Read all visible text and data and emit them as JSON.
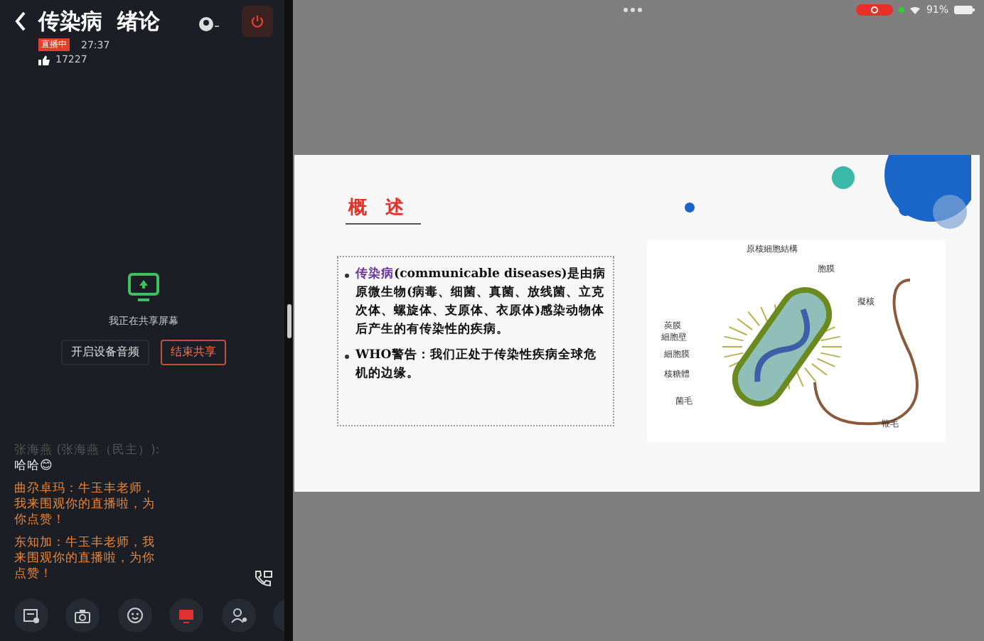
{
  "live": {
    "title": "传染病  绪论",
    "status_badge": "直播中",
    "duration": "27:37",
    "likes": "17227"
  },
  "sharing": {
    "message": "我正在共享屏幕",
    "buttons": [
      {
        "label": "开启设备音频",
        "kind": "neutral"
      },
      {
        "label": "结束共享",
        "kind": "danger"
      }
    ]
  },
  "chat": [
    {
      "text": "张海燕 (张海燕（民主）):",
      "kind": "faded"
    },
    {
      "text": "哈哈😊",
      "kind": "normal"
    },
    {
      "text": "曲尕卓玛：牛玉丰老师，我来围观你的直播啦，为你点赞！",
      "kind": "highlight"
    },
    {
      "text": "东知加：牛玉丰老师，我来围观你的直播啦，为你点赞！",
      "kind": "highlight"
    }
  ],
  "status_bar": {
    "battery": "91%"
  },
  "slide": {
    "title": "概　述",
    "bullets": [
      {
        "term": "传染病",
        "text": "(communicable diseases)是由病原微生物(病毒、细菌、真菌、放线菌、立克次体、螺旋体、支原体、衣原体)感染动物体后产生的有传染性的疾病。"
      },
      {
        "text": "WHO警告：我们正处于传染性疾病全球危机的边缘。"
      }
    ],
    "diagram": {
      "title": "原核細胞結構",
      "labels": [
        "胞膜",
        "擬核",
        "莢膜",
        "細胞壁",
        "細胞膜",
        "核糖體",
        "菌毛",
        "鞭毛"
      ]
    }
  }
}
